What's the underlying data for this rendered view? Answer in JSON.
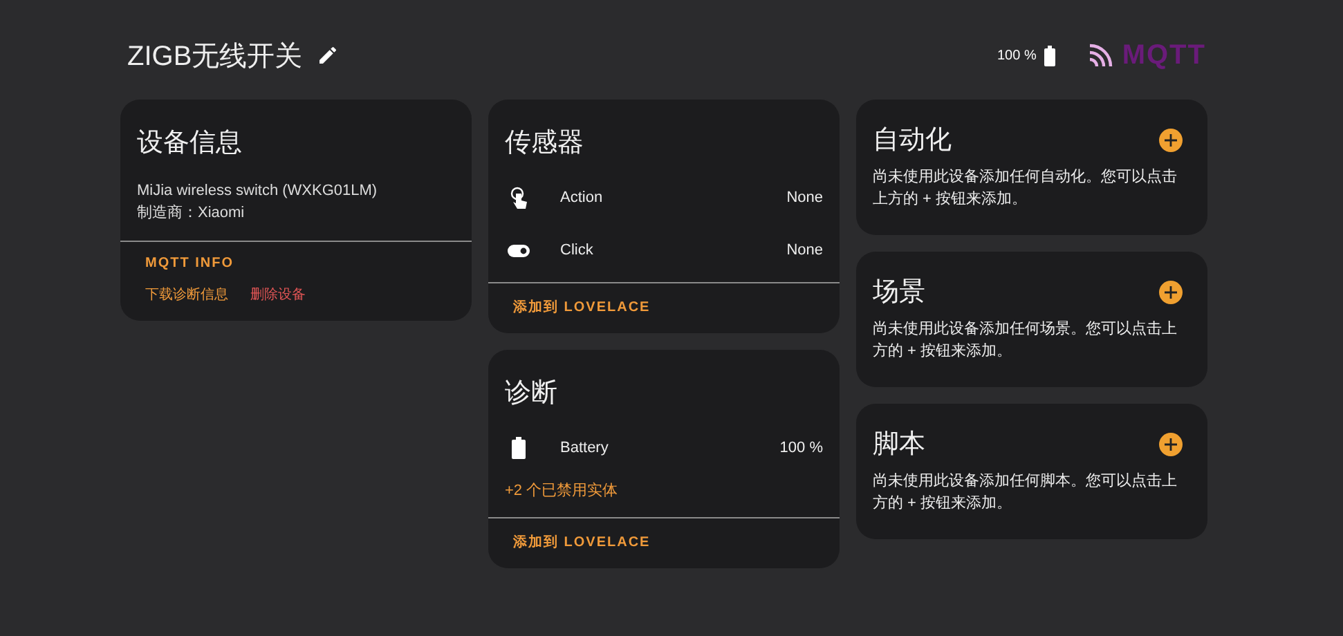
{
  "header": {
    "title": "ZIGB无线开关",
    "battery": "100 %",
    "logo": "MQTT"
  },
  "device_info": {
    "title": "设备信息",
    "model": "MiJia wireless switch (WXKG01LM)",
    "manufacturer": "制造商：Xiaomi",
    "mqtt_info": "MQTT INFO",
    "download": "下载诊断信息",
    "delete": "删除设备"
  },
  "sensors": {
    "title": "传感器",
    "entities": [
      {
        "kind": "touch",
        "name": "Action",
        "value": "None"
      },
      {
        "kind": "toggle",
        "name": "Click",
        "value": "None"
      }
    ],
    "add": "添加到 LOVELACE"
  },
  "diagnostics": {
    "title": "诊断",
    "entities": [
      {
        "kind": "battery",
        "name": "Battery",
        "value": "100 %"
      }
    ],
    "disabled": "+2 个已禁用实体",
    "add": "添加到 LOVELACE"
  },
  "side_cards": [
    {
      "title": "自动化",
      "text": "尚未使用此设备添加任何自动化。您可以点击上方的 + 按钮来添加。"
    },
    {
      "title": "场景",
      "text": "尚未使用此设备添加任何场景。您可以点击上方的 + 按钮来添加。"
    },
    {
      "title": "脚本",
      "text": "尚未使用此设备添加任何脚本。您可以点击上方的 + 按钮来添加。"
    }
  ]
}
